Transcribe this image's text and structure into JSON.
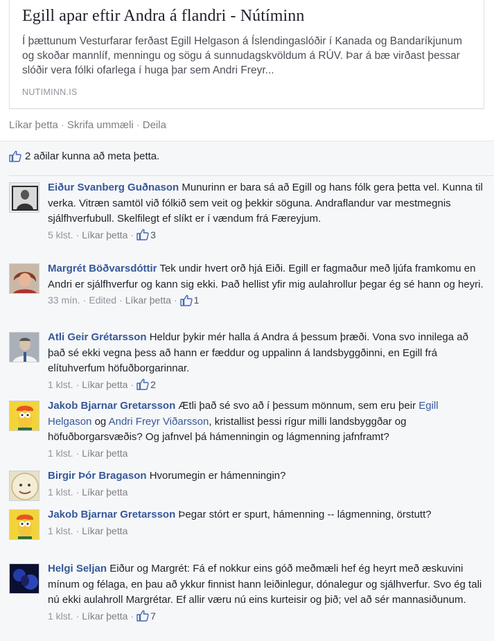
{
  "link_card": {
    "title": "Egill apar eftir Andra á flandri - Nútíminn",
    "description": "Í þættunum Vesturfarar ferðast Egill Helgason á Íslendingaslóðir í Kanada og Bandaríkjunum og skoðar mannlíf, menningu og sögu á sunnudagskvöldum á RÚV. Þar á bæ virðast þessar slóðir vera fólki ofarlega í huga þar sem Andri Freyr...",
    "source": "NUTIMINN.IS"
  },
  "actions": {
    "like": "Líkar þetta",
    "comment": "Skrifa ummæli",
    "share": "Deila",
    "separator": "·"
  },
  "likes_summary": {
    "icon": "thumbs-up-icon",
    "text": "2 aðilar kunna að meta þetta."
  },
  "comments": [
    {
      "name": "Eiður Svanberg Guðnason",
      "text": "Munurinn er bara sá að Egill og hans fólk gera þetta vel. Kunna til verka. Vitræn samtöl við fólkið sem veit og þekkir söguna. Andraflandur var mestmegnis sjálfhverfubull. Skelfilegt ef slíkt er í vændum frá Færeyjum.",
      "time": "5 klst.",
      "edited": "",
      "like_label": "Líkar þetta",
      "likes": "3"
    },
    {
      "name": "Margrét Böðvarsdóttir",
      "text": "Tek undir hvert orð hjá Eiði. Egill er fagmaður með ljúfa framkomu en Andri er sjálfhverfur og kann sig ekki. Það hellist yfir mig aulahrollur þegar ég sé hann og heyri.",
      "time": "33 mín.",
      "edited": "Edited",
      "like_label": "Líkar þetta",
      "likes": "1"
    },
    {
      "name": "Atli Geir Grétarsson",
      "text": "Heldur þykir mér halla á Andra á þessum þræði. Vona svo innilega að það sé ekki vegna þess að hann er fæddur og uppalinn á landsbyggðinni, en Egill frá elítuhverfum höfuðborgarinnar.",
      "time": "1 klst.",
      "edited": "",
      "like_label": "Líkar þetta",
      "likes": "2"
    },
    {
      "name": "Jakob Bjarnar Gretarsson",
      "text_pre": "Ætli það sé svo að í þessum mönnum, sem eru þeir",
      "mention1": "Egill Helgason",
      "text_mid": "og",
      "mention2": "Andri Freyr Viðarsson",
      "text_post": ", kristallist þessi rígur milli landsbyggðar og höfuðborgarsvæðis? Og jafnvel þá hámenningin og lágmenning jafnframt?",
      "time": "1 klst.",
      "like_label": "Líkar þetta"
    },
    {
      "name": "Birgir Þór Bragason",
      "text": "Hvorumegin er hámenningin?",
      "time": "1 klst.",
      "like_label": "Líkar þetta"
    },
    {
      "name": "Jakob Bjarnar Gretarsson",
      "text": "Þegar stórt er spurt, hámenning -- lágmenning, örstutt?",
      "time": "1 klst.",
      "like_label": "Líkar þetta"
    },
    {
      "name": "Helgi Seljan",
      "text": "Eiður og Margrét: Fá ef nokkur eins góð meðmæli hef ég heyrt með æskuvini mínum og félaga, en þau að ykkur finnist hann leiðinlegur, dónalegur og sjálhverfur. Svo ég tali nú ekki aulahroll Margrétar. Ef allir væru nú eins kurteisir og þið; vel að sér mannasiðunum.",
      "time": "1 klst.",
      "like_label": "Líkar þetta",
      "likes": "7"
    }
  ],
  "colors": {
    "name_link": "#365899",
    "meta_gray": "#90949c",
    "panel_bg": "#f6f7f9"
  }
}
